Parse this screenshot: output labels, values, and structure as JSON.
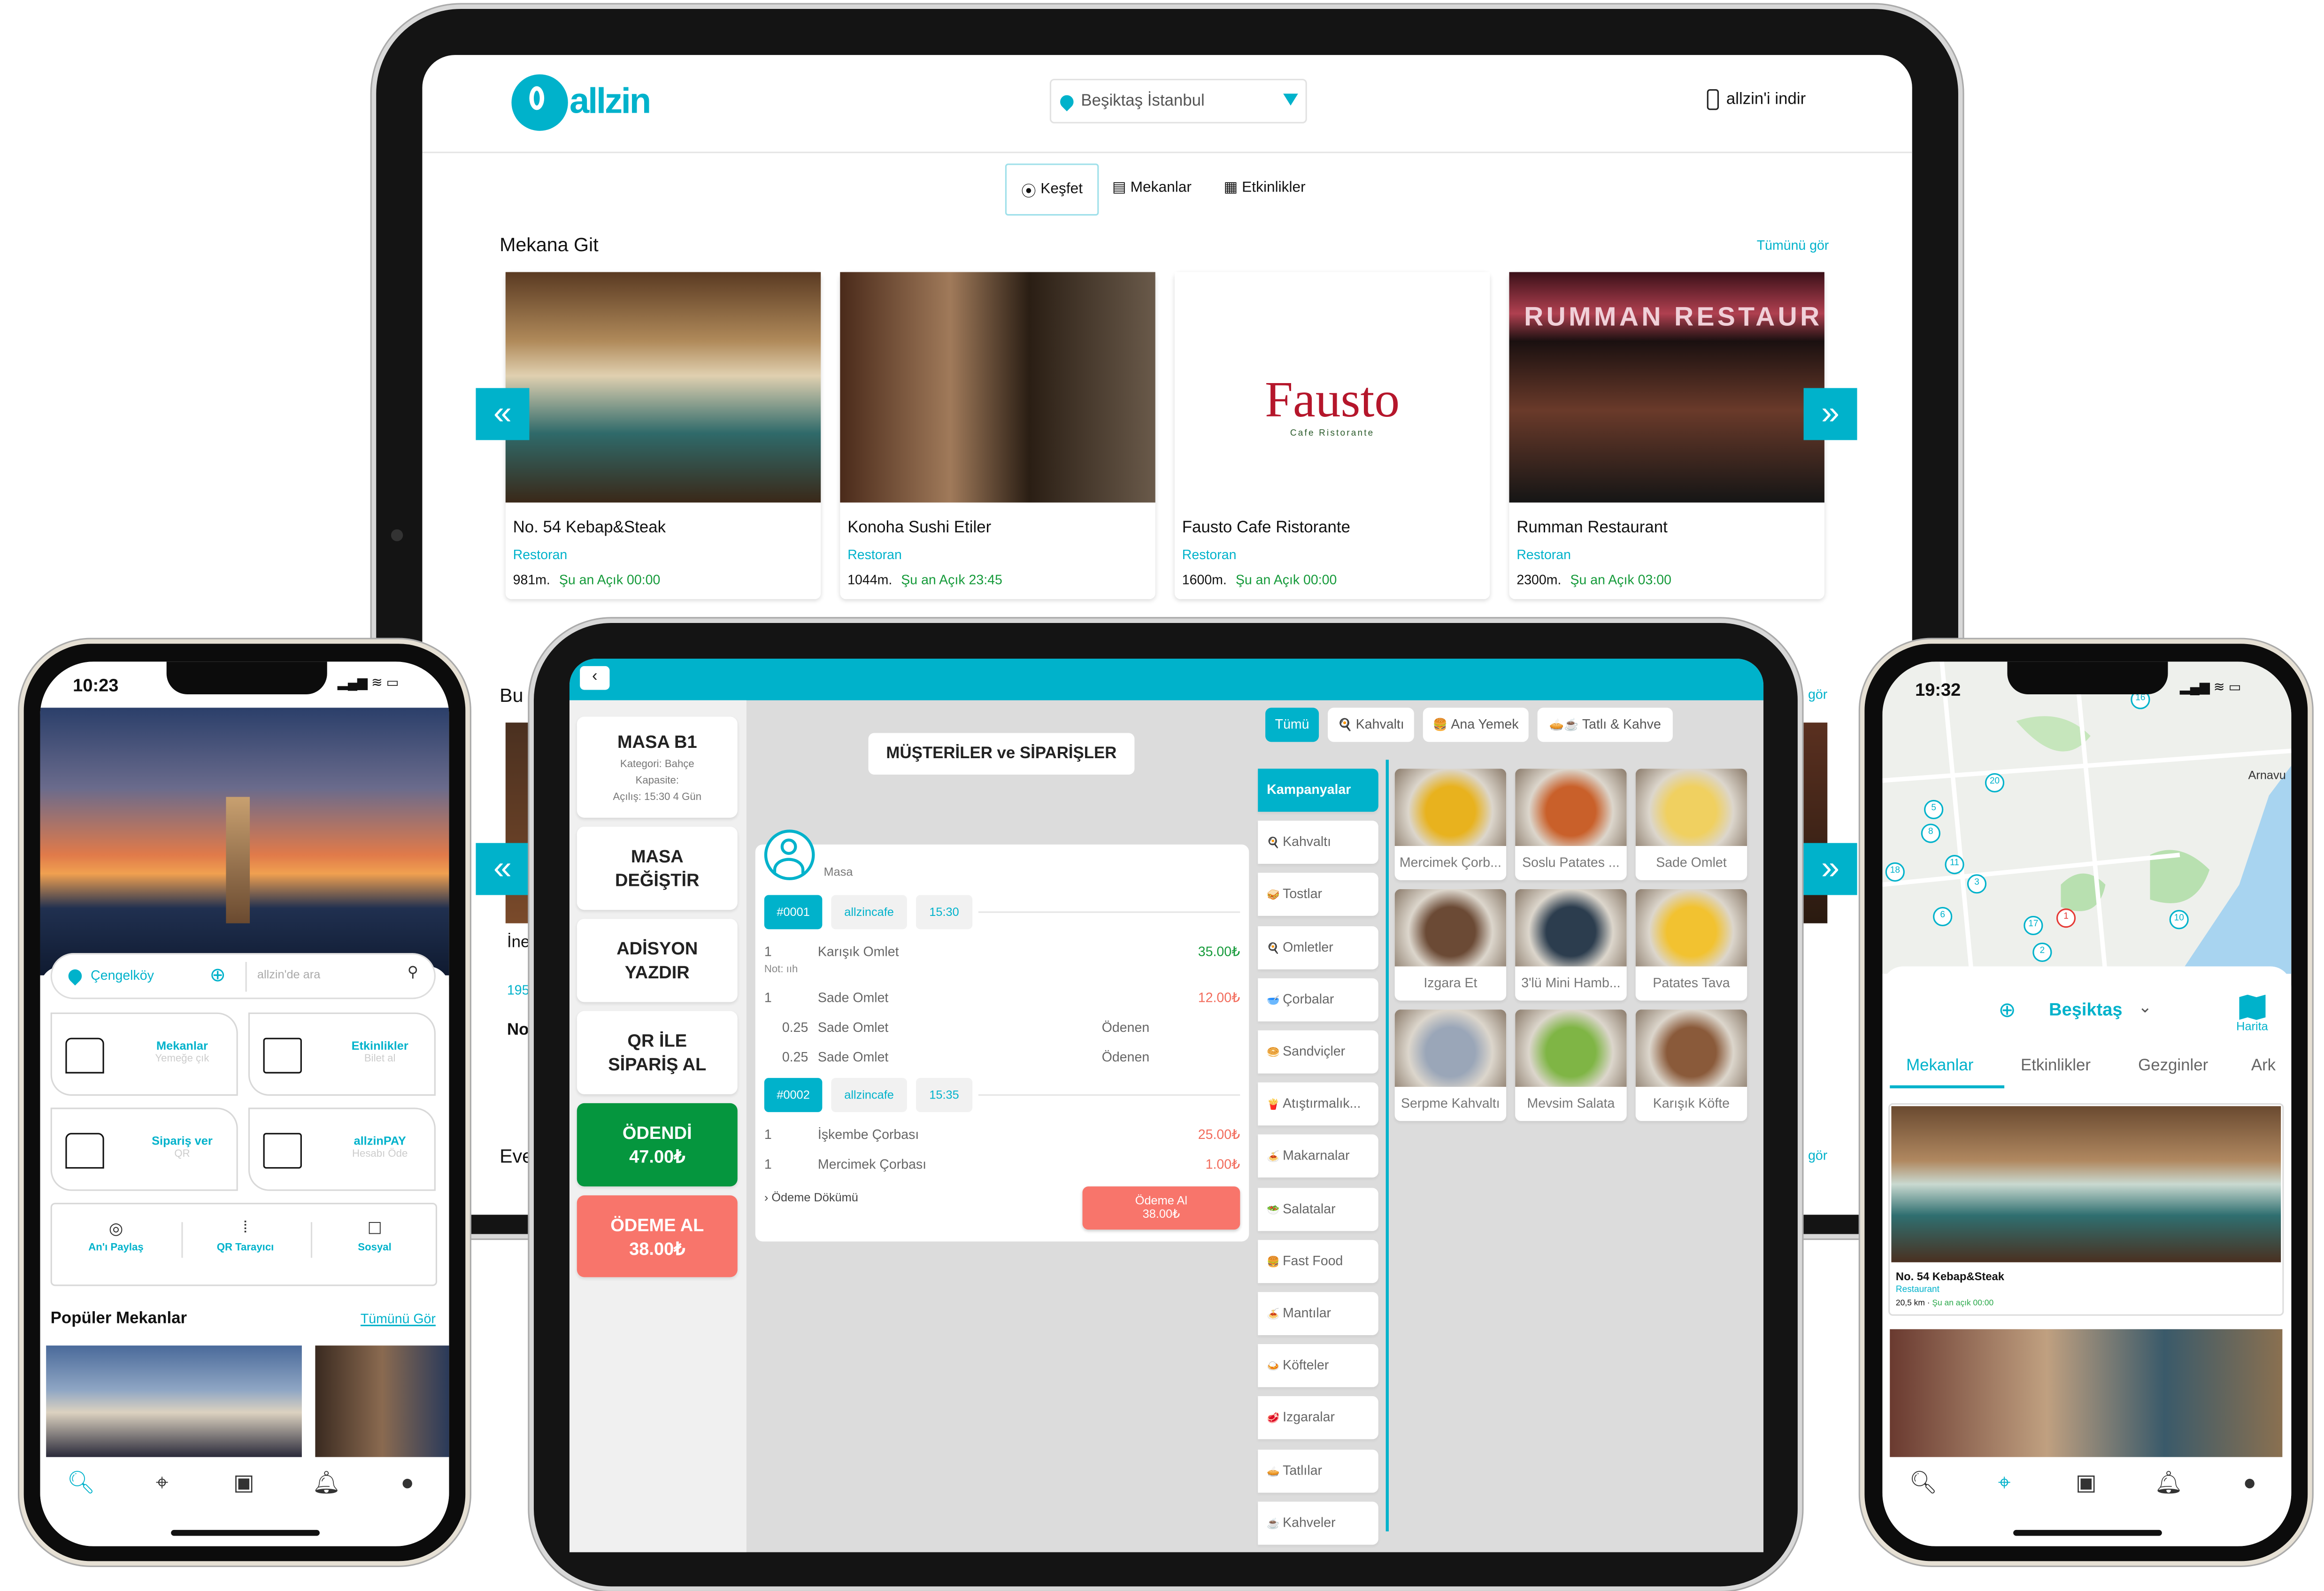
{
  "colors": {
    "accent": "#00b2cb",
    "paid": "#05963e",
    "pay": "#f8756b",
    "price_red": "#f26b5b",
    "price_green": "#159a3a"
  },
  "web": {
    "logo": "allzin",
    "location": "Beşiktaş İstanbul",
    "download": "allzin'i indir",
    "tabs": [
      {
        "label": "Keşfet",
        "icon": "map-pin-icon",
        "active": true
      },
      {
        "label": "Mekanlar",
        "icon": "store-icon"
      },
      {
        "label": "Etkinlikler",
        "icon": "calendar-icon"
      }
    ],
    "section_title": "Mekana Git",
    "see_all": "Tümünü gör",
    "venues": [
      {
        "name": "No. 54 Kebap&Steak",
        "type": "Restoran",
        "distance": "981m.",
        "status": "Şu an Açık 00:00"
      },
      {
        "name": "Konoha Sushi Etiler",
        "type": "Restoran",
        "distance": "1044m.",
        "status": "Şu an Açık 23:45"
      },
      {
        "name": "Fausto Cafe Ristorante",
        "type": "Restoran",
        "distance": "1600m.",
        "status": "Şu an Açık 00:00",
        "logo_text": "Fausto",
        "logo_sub": "Cafe Ristorante"
      },
      {
        "name": "Rumman Restaurant",
        "type": "Restoran",
        "distance": "2300m.",
        "status": "Şu an Açık 03:00",
        "sign_text": "RUMMAN RESTAUR"
      }
    ],
    "partial": {
      "section2": "Bu",
      "section3": "Eve",
      "see_all_cut": "gör",
      "card_title_cut": "İne",
      "card_num_cut": "195",
      "card_name_cut": "No"
    }
  },
  "pos": {
    "table": {
      "title": "MASA B1",
      "category": "Kategori: Bahçe",
      "capacity": "Kapasite:",
      "opened": "Açılış: 15:30 4 Gün"
    },
    "actions": {
      "change_table": "MASA DEĞİŞTİR",
      "print_bill": "ADİSYON YAZDIR",
      "qr_order": "QR İLE SİPARİŞ AL"
    },
    "paid": {
      "label": "ÖDENDİ",
      "amount": "47.00₺"
    },
    "collect": {
      "label": "ÖDEME AL",
      "amount": "38.00₺"
    },
    "title": "MÜŞTERİLER ve SİPARİŞLER",
    "customer": "Masa",
    "orders": [
      {
        "no": "#0001",
        "source": "allzincafe",
        "time": "15:30"
      },
      {
        "no": "#0002",
        "source": "allzincafe",
        "time": "15:35"
      }
    ],
    "lines": {
      "l1": {
        "qty": "1",
        "name": "Karışık Omlet",
        "price": "35.00₺",
        "note": "Not: ııh"
      },
      "l2": {
        "qty": "1",
        "name": "Sade Omlet",
        "price": "12.00₺"
      },
      "l3": {
        "qty": "0.25",
        "name": "Sade Omlet",
        "status": "Ödenen"
      },
      "l4": {
        "qty": "0.25",
        "name": "Sade Omlet",
        "status": "Ödenen"
      },
      "l5": {
        "qty": "1",
        "name": "İşkembe Çorbası",
        "price": "25.00₺"
      },
      "l6": {
        "qty": "1",
        "name": "Mercimek Çorbası",
        "price": "1.00₺"
      }
    },
    "breakdown": "Ödeme Dökümü",
    "pay_button": {
      "label": "Ödeme Al",
      "amount": "38.00₺"
    },
    "filters": [
      {
        "label": "Tümü",
        "emoji": ""
      },
      {
        "label": "Kahvaltı",
        "emoji": "🍳"
      },
      {
        "label": "Ana Yemek",
        "emoji": "🍔"
      },
      {
        "label": "Tatlı & Kahve",
        "emoji": "🥧☕"
      }
    ],
    "categories": [
      {
        "label": "Kampanyalar",
        "emoji": ""
      },
      {
        "label": "Kahvaltı",
        "emoji": "🍳"
      },
      {
        "label": "Tostlar",
        "emoji": "🥪"
      },
      {
        "label": "Omletler",
        "emoji": "🍳"
      },
      {
        "label": "Çorbalar",
        "emoji": "🥣"
      },
      {
        "label": "Sandviçler",
        "emoji": "🥯"
      },
      {
        "label": "Atıştırmalık...",
        "emoji": "🍟"
      },
      {
        "label": "Makarnalar",
        "emoji": "🍝"
      },
      {
        "label": "Salatalar",
        "emoji": "🥗"
      },
      {
        "label": "Fast Food",
        "emoji": "🍔"
      },
      {
        "label": "Mantılar",
        "emoji": "🍝"
      },
      {
        "label": "Köfteler",
        "emoji": "🍛"
      },
      {
        "label": "Izgaralar",
        "emoji": "🥩"
      },
      {
        "label": "Tatlılar",
        "emoji": "🥧"
      },
      {
        "label": "Kahveler",
        "emoji": "☕"
      }
    ],
    "products": [
      {
        "label": "Mercimek Çorb...",
        "color": "#e8b21e"
      },
      {
        "label": "Soslu Patates ...",
        "color": "#c9602a"
      },
      {
        "label": "Sade Omlet",
        "color": "#f0d060"
      },
      {
        "label": "Izgara Et",
        "color": "#6b4a35"
      },
      {
        "label": "3'lü Mini Hamb...",
        "color": "#2c3d4e"
      },
      {
        "label": "Patates Tava",
        "color": "#f2c230"
      },
      {
        "label": "Serpme Kahvaltı",
        "color": "#9aa6b8"
      },
      {
        "label": "Mevsim Salata",
        "color": "#7fb545"
      },
      {
        "label": "Karışık Köfte",
        "color": "#8a5a3a"
      }
    ]
  },
  "phone_left": {
    "time": "10:23",
    "location": "Çengelköy",
    "search_placeholder": "allzin'de ara",
    "tiles": [
      {
        "title": "Mekanlar",
        "sub": "Yemeğe çık",
        "icon": "store-icon"
      },
      {
        "title": "Etkinlikler",
        "sub": "Bilet al",
        "icon": "calendar-icon"
      },
      {
        "title": "Sipariş ver",
        "sub": "QR",
        "icon": "table-chairs-icon"
      },
      {
        "title": "allzinPAY",
        "sub": "Hesabı Öde",
        "icon": "pos-terminal-icon"
      }
    ],
    "quick": [
      {
        "label": "An'ı Paylaş",
        "icon": "camera-icon"
      },
      {
        "label": "QR Tarayıcı",
        "icon": "qr-scan-icon"
      },
      {
        "label": "Sosyal",
        "icon": "chat-icon"
      }
    ],
    "popular_title": "Popüler Mekanlar",
    "see_all": "Tümünü Gör",
    "nav": [
      "search-icon",
      "map-pin-icon",
      "wallet-icon",
      "bell-icon",
      "avatar-icon"
    ],
    "active_nav": 0
  },
  "phone_right": {
    "time": "19:32",
    "location": "Beşiktaş",
    "map_label": "Harita",
    "map_place": "Arnavu",
    "markers": [
      "20",
      "5",
      "8",
      "11",
      "18",
      "3",
      "6",
      "17",
      "2",
      "1",
      "10",
      "16"
    ],
    "tabs": [
      "Mekanlar",
      "Etkinlikler",
      "Gezginler",
      "Ark"
    ],
    "active_tab": 0,
    "venue": {
      "name": "No. 54 Kebap&Steak",
      "type": "Restaurant",
      "distance": "20,5 km ·",
      "status": "Şu an açık 00:00"
    },
    "nav": [
      "search-icon",
      "map-pin-icon",
      "wallet-icon",
      "bell-icon",
      "avatar-icon"
    ],
    "active_nav": 1
  }
}
